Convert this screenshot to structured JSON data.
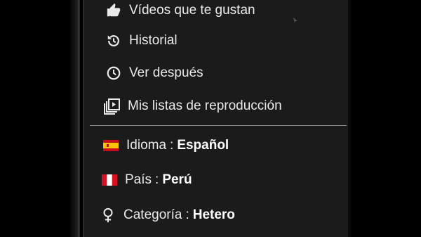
{
  "menu": {
    "liked_videos_label": "Vídeos que te gustan",
    "history_label": "Historial",
    "watch_later_label": "Ver después",
    "playlists_label": "Mis listas de reproducción"
  },
  "settings": {
    "language": {
      "label": "Idioma",
      "separator": ":",
      "value": "Español"
    },
    "country": {
      "label": "País",
      "separator": ":",
      "value": "Perú"
    },
    "category": {
      "label": "Categoría",
      "separator": ":",
      "value": "Hetero"
    }
  },
  "icons": {
    "liked": "thumbs-up-icon",
    "history": "history-icon",
    "watch_later": "clock-icon",
    "playlists": "playlists-icon",
    "language": "spain-flag-icon",
    "country": "peru-flag-icon",
    "category": "female-symbol-icon"
  },
  "colors": {
    "background": "#1c1b1c",
    "text": "#eaeaea",
    "divider": "#8a8a8a",
    "spain_red": "#c60b1e",
    "spain_yellow": "#ffc400",
    "peru_red": "#d91023"
  }
}
